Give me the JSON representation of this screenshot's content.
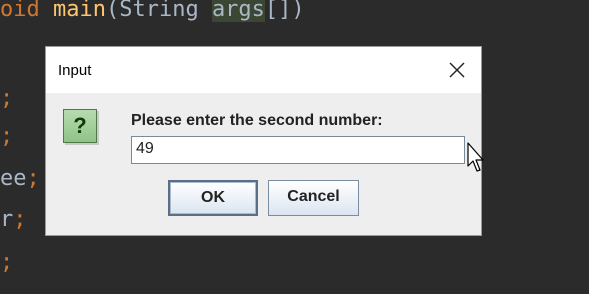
{
  "editor": {
    "lines": [
      {
        "kw": "oid ",
        "fn": "main",
        "pl": "(String ",
        "hl": "args",
        "tail": "[])"
      },
      {
        "text": ";"
      },
      {
        "text": ";"
      },
      {
        "pre": "ee",
        "text": ";"
      },
      {
        "pre": "r",
        "text": ";"
      },
      {
        "text": ";"
      }
    ]
  },
  "dialog": {
    "title": "Input",
    "prompt": "Please enter the second number:",
    "input_value": "49",
    "ok_label": "OK",
    "cancel_label": "Cancel",
    "icon_glyph": "?"
  },
  "icons": {
    "close": "close-icon",
    "question": "question-icon",
    "cursor": "mouse-cursor"
  },
  "colors": {
    "editor_bg": "#2b2b2b",
    "keyword": "#cc7832",
    "function": "#ffc66d",
    "plain": "#a9b7c6",
    "dialog_bg": "#eeeeee"
  }
}
